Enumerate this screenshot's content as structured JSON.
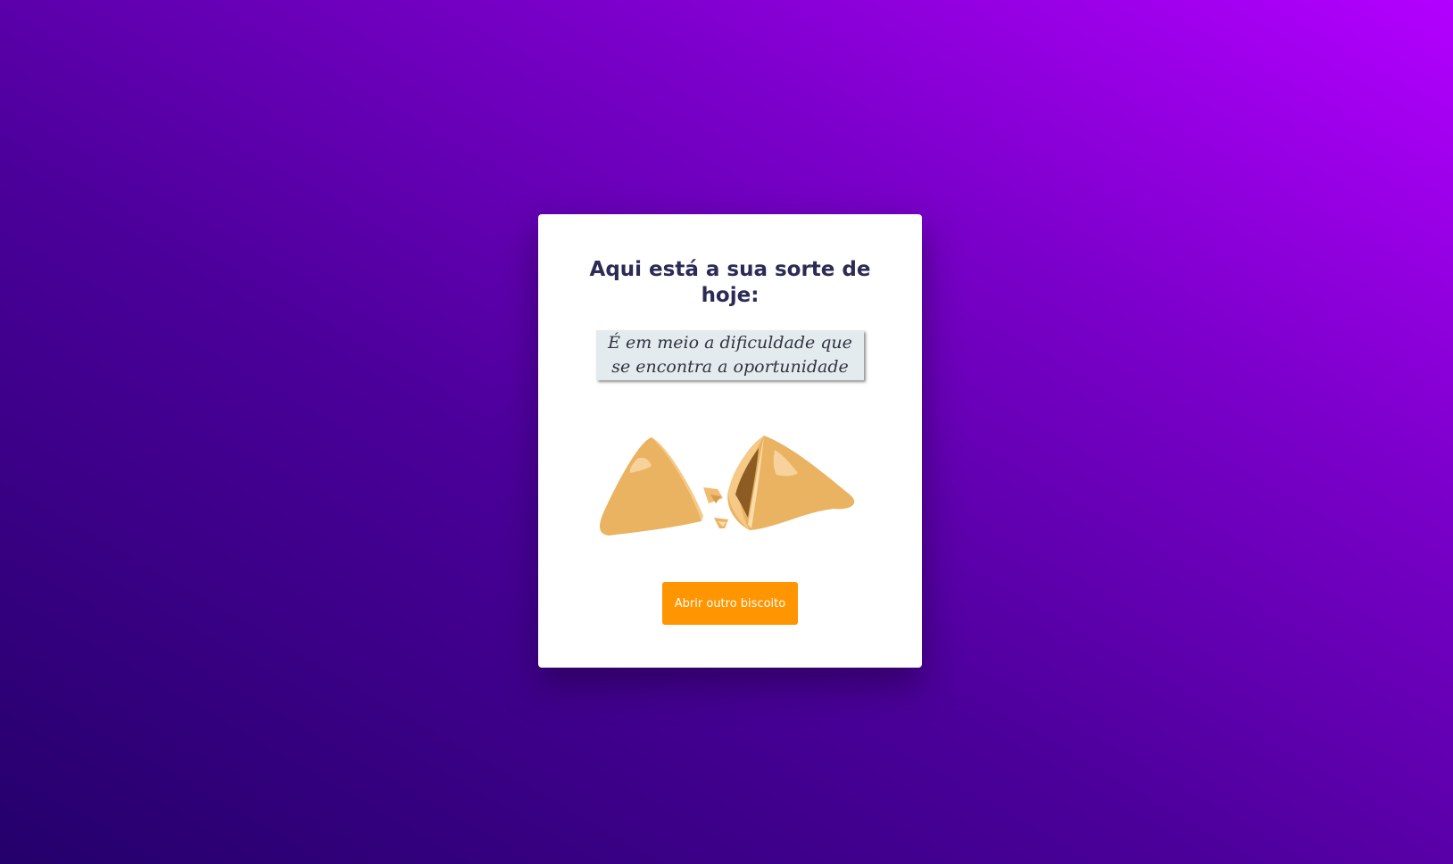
{
  "card": {
    "title": "Aqui está a sua sorte de hoje:",
    "fortune": "É em meio a dificuldade que se encontra a oportunidade",
    "illustration": "broken-fortune-cookie",
    "button_label": "Abrir outro biscoito"
  },
  "colors": {
    "background_start": "#24006b",
    "background_end": "#b300ff",
    "title": "#2b2b55",
    "note_paper": "#e3ebef",
    "button": "#ff9500",
    "cookie": "#e9b362"
  }
}
